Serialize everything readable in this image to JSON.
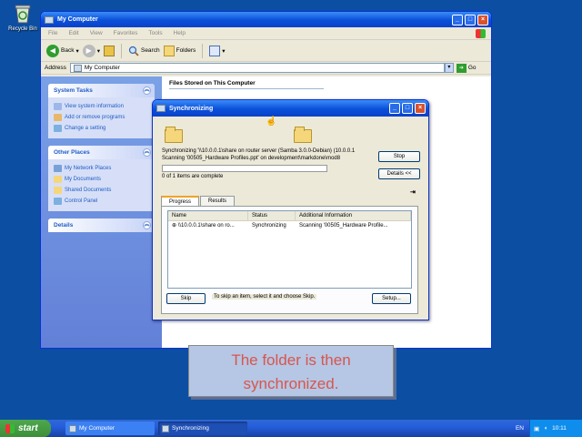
{
  "desktop": {
    "recycle_bin_label": "Recycle Bin"
  },
  "window": {
    "title": "My Computer",
    "menu": [
      "File",
      "Edit",
      "View",
      "Favorites",
      "Tools",
      "Help"
    ],
    "toolbar": {
      "back": "Back",
      "search": "Search",
      "folders": "Folders"
    },
    "address": {
      "label": "Address",
      "value": "My Computer",
      "go": "Go"
    },
    "left_panels": {
      "system_tasks": {
        "title": "System Tasks",
        "items": [
          "View system information",
          "Add or remove programs",
          "Change a setting"
        ]
      },
      "other_places": {
        "title": "Other Places",
        "items": [
          "My Network Places",
          "My Documents",
          "Shared Documents",
          "Control Panel"
        ]
      },
      "details": {
        "title": "Details"
      }
    },
    "section_title": "Files Stored on This Computer"
  },
  "dialog": {
    "title": "Synchronizing",
    "line1": "Synchronizing '\\\\10.0.0.1\\share on router server (Samba 3.0.0-Debian) (10.0.0.1",
    "line2": "Scanning '00505_Hardware Profiles.ppt' on development\\markdone\\mod8",
    "progress": 0.0,
    "count_text": "0 of 1 items are complete",
    "stop_button": "Stop",
    "details_button": "Details <<",
    "tabs": [
      "Progress",
      "Results"
    ],
    "columns": [
      "Name",
      "Status",
      "Additional Information"
    ],
    "rows": [
      {
        "name": "\\\\10.0.0.1\\share on ro...",
        "status": "Synchronizing",
        "info": "Scanning '00505_Hardware Profile..."
      }
    ],
    "skip_button": "Skip",
    "skip_hint": "To skip an item, select it and choose Skip.",
    "setup_button": "Setup..."
  },
  "caption": {
    "line1": "The folder is then",
    "line2": "synchronized."
  },
  "taskbar": {
    "start": "start",
    "tasks": [
      "My Computer",
      "Synchronizing"
    ],
    "language": "EN",
    "time": "10:11"
  },
  "colors": {
    "desktop": "#0b4ea2",
    "caption_text": "#d8554f",
    "caption_bg": "#b5c7e4"
  }
}
